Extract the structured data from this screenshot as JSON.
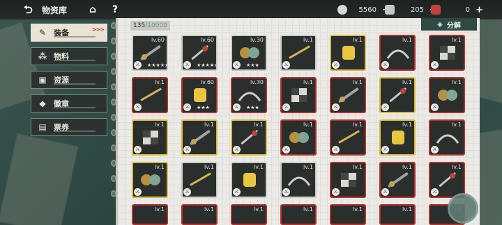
{
  "header": {
    "title": "物资库",
    "resources": [
      {
        "icon": "coin-icon",
        "value": "5560",
        "color": "#d8d8d8"
      },
      {
        "icon": "ticket-icon",
        "value": "205",
        "color": "#c8c8c8"
      },
      {
        "icon": "supply-crate-icon",
        "value": "0",
        "color": "#c0443c"
      }
    ],
    "plus": "+",
    "help": "?"
  },
  "sidebar": {
    "items": [
      {
        "label": "装备",
        "icon": "equipment-icon",
        "active": true,
        "tag": ">>>"
      },
      {
        "label": "物料",
        "icon": "materials-icon"
      },
      {
        "label": "资源",
        "icon": "resources-icon"
      },
      {
        "label": "徽章",
        "icon": "badge-icon"
      },
      {
        "label": "票券",
        "icon": "ticket-list-icon"
      }
    ]
  },
  "panel": {
    "capacity_current": "135",
    "capacity_max": "/10000",
    "decompose_label": "分解"
  },
  "items": [
    [
      {
        "lv": "lv.60",
        "rarity": "white",
        "stars": "★★★★★"
      },
      {
        "lv": "lv.60",
        "rarity": "white",
        "stars": "★★★★★"
      },
      {
        "lv": "lv.30",
        "rarity": "white",
        "stars": "★★★"
      },
      {
        "lv": "lv.1",
        "rarity": "white"
      },
      {
        "lv": "lv.1",
        "rarity": "yellow"
      },
      {
        "lv": "lv.1",
        "rarity": "red"
      },
      {
        "lv": "lv.1",
        "rarity": "red"
      }
    ],
    [
      {
        "lv": "lv.1",
        "rarity": "red"
      },
      {
        "lv": "lv.60",
        "rarity": "red",
        "stars": "★★★"
      },
      {
        "lv": "lv.30",
        "rarity": "red",
        "stars": "★★★"
      },
      {
        "lv": "lv.1",
        "rarity": "red"
      },
      {
        "lv": "lv.1",
        "rarity": "red"
      },
      {
        "lv": "lv.1",
        "rarity": "yellow"
      },
      {
        "lv": "lv.1",
        "rarity": "red"
      }
    ],
    [
      {
        "lv": "lv.1",
        "rarity": "yellow"
      },
      {
        "lv": "lv.1",
        "rarity": "yellow"
      },
      {
        "lv": "lv.1",
        "rarity": "yellow"
      },
      {
        "lv": "lv.1",
        "rarity": "red"
      },
      {
        "lv": "lv.1",
        "rarity": "red"
      },
      {
        "lv": "lv.1",
        "rarity": "yellow"
      },
      {
        "lv": "lv.1",
        "rarity": "red"
      }
    ],
    [
      {
        "lv": "lv.1",
        "rarity": "yellow"
      },
      {
        "lv": "lv.1",
        "rarity": "white"
      },
      {
        "lv": "lv.1",
        "rarity": "white"
      },
      {
        "lv": "lv.1",
        "rarity": "white"
      },
      {
        "lv": "lv.1",
        "rarity": "red"
      },
      {
        "lv": "lv.1",
        "rarity": "red"
      },
      {
        "lv": "lv.1",
        "rarity": "red"
      }
    ],
    [
      {
        "lv": "lv.1",
        "rarity": "red"
      },
      {
        "lv": "lv.1",
        "rarity": "red"
      },
      {
        "lv": "lv.1",
        "rarity": "red"
      },
      {
        "lv": "lv.1",
        "rarity": "red"
      },
      {
        "lv": "lv.1",
        "rarity": "red"
      },
      {
        "lv": "lv.1",
        "rarity": "red"
      },
      {
        "lv": "lv.1",
        "rarity": "red"
      }
    ]
  ]
}
